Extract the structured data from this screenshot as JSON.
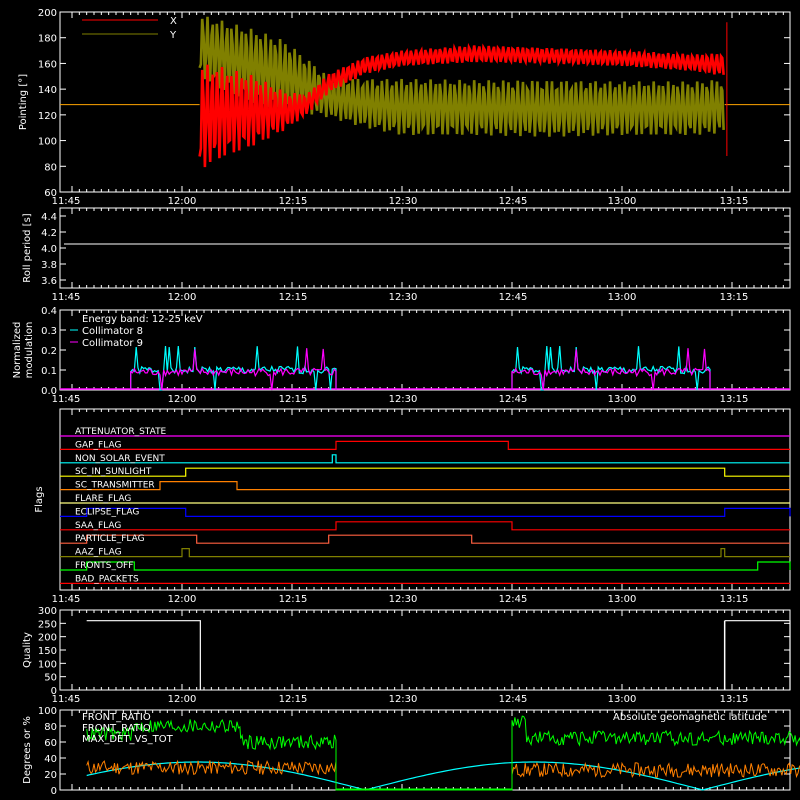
{
  "chart_data": [
    {
      "type": "line",
      "ylabel": "Pointing [°]",
      "ylim": [
        60,
        200
      ],
      "yticks": [
        "60",
        "80",
        "100",
        "120",
        "140",
        "160",
        "180",
        "200"
      ],
      "xticks": [
        "11:45",
        "12:00",
        "12:15",
        "12:30",
        "12:45",
        "13:00",
        "13:15"
      ],
      "xrange_minutes": [
        -1,
        59
      ],
      "series": [
        {
          "name": "X",
          "color": "#ff0000",
          "envelope": [
            [
              2.2,
              null,
              null
            ],
            [
              2.4,
              76,
              160
            ],
            [
              5,
              85,
              158
            ],
            [
              10,
              96,
              150
            ],
            [
              14,
              108,
              138
            ],
            [
              17,
              120,
              136
            ],
            [
              20,
              137,
              152
            ],
            [
              25,
              152,
              165
            ],
            [
              30,
              158,
              170
            ],
            [
              40,
              161,
              174
            ],
            [
              50,
              160,
              172
            ],
            [
              60,
              158,
              170
            ],
            [
              70,
              154,
              167
            ],
            [
              74,
              150,
              168
            ]
          ]
        },
        {
          "name": "Y",
          "color": "#808000",
          "envelope": [
            [
              2.4,
              150,
              198
            ],
            [
              5,
              140,
              194
            ],
            [
              10,
              128,
              186
            ],
            [
              14,
              122,
              178
            ],
            [
              17,
              121,
              164
            ],
            [
              20,
              118,
              150
            ],
            [
              25,
              110,
              148
            ],
            [
              30,
              104,
              148
            ],
            [
              40,
              104,
              147
            ],
            [
              50,
              103,
              147
            ],
            [
              60,
              104,
              146
            ],
            [
              70,
              104,
              146
            ],
            [
              74,
              106,
              148
            ]
          ]
        }
      ],
      "baseline": 128
    },
    {
      "type": "line",
      "ylabel": "Roll period [s]",
      "ylim": [
        3.5,
        4.5
      ],
      "yticks": [
        "3.6",
        "3.8",
        "4.0",
        "4.2",
        "4.4"
      ],
      "xticks": [
        "11:45",
        "12:00",
        "12:15",
        "12:30",
        "12:45",
        "13:00",
        "13:15"
      ],
      "value": 4.05
    },
    {
      "type": "line",
      "ylabel": "Normalized modulation",
      "ylim": [
        0,
        0.4
      ],
      "yticks": [
        "0.0",
        "0.1",
        "0.2",
        "0.3",
        "0.4"
      ],
      "xticks": [
        "11:45",
        "12:00",
        "12:15",
        "12:30",
        "12:45",
        "13:00",
        "13:15"
      ],
      "annotation": "Energy band: 12-25 keV",
      "series": [
        {
          "name": "Collimator 8",
          "color": "#00ffff",
          "segments": [
            [
              -7,
              21
            ],
            [
              45,
              72
            ]
          ],
          "level": 0.1
        },
        {
          "name": "Collimator 9",
          "color": "#ff00ff",
          "segments": [
            [
              -7,
              21
            ],
            [
              45,
              72
            ]
          ],
          "level": 0.09
        }
      ]
    },
    {
      "type": "line",
      "ylabel": "Flags",
      "xticks": [
        "11:45",
        "12:00",
        "12:15",
        "12:30",
        "12:45",
        "13:00",
        "13:15"
      ],
      "flags": [
        {
          "name": "ATTENUATOR_STATE",
          "color": "#ff00ff",
          "highs": []
        },
        {
          "name": "GAP_FLAG",
          "color": "#ff0000",
          "highs": [
            [
              21,
              44.5
            ]
          ]
        },
        {
          "name": "NON_SOLAR_EVENT",
          "color": "#00ffff",
          "highs": [
            [
              20.5,
              21
            ]
          ]
        },
        {
          "name": "SC_IN_SUNLIGHT",
          "color": "#ffff00",
          "highs": [
            [
              0.5,
              74
            ]
          ]
        },
        {
          "name": "SC_TRANSMITTER",
          "color": "#ff8000",
          "highs": [
            [
              -3,
              7.5
            ]
          ]
        },
        {
          "name": "FLARE_FLAG",
          "color": "#ffff80",
          "highs": []
        },
        {
          "name": "ECLIPSE_FLAG",
          "color": "#0000ff",
          "highs": [
            [
              -13,
              0.5
            ],
            [
              74,
              90
            ]
          ]
        },
        {
          "name": "SAA_FLAG",
          "color": "#ff0000",
          "highs": [
            [
              21,
              45
            ]
          ]
        },
        {
          "name": "PARTICLE_FLAG",
          "color": "#ff6040",
          "highs": [
            [
              -13,
              2
            ],
            [
              20,
              39.5
            ]
          ]
        },
        {
          "name": "AAZ_FLAG",
          "color": "#808000",
          "highs": [
            [
              0,
              1
            ],
            [
              73.5,
              74
            ]
          ]
        },
        {
          "name": "FRONTS_OFF",
          "color": "#00ff00",
          "highs": [
            [
              -13,
              -6.5
            ],
            [
              78.5,
              90
            ]
          ]
        },
        {
          "name": "BAD_PACKETS",
          "color": "#ff0000",
          "highs": []
        }
      ]
    },
    {
      "type": "line",
      "ylabel": "Quality",
      "ylim": [
        0,
        300
      ],
      "yticks": [
        "0",
        "50",
        "100",
        "150",
        "200",
        "250",
        "300"
      ],
      "xticks": [
        "11:45",
        "12:00",
        "12:15",
        "12:30",
        "12:45",
        "13:00",
        "13:15"
      ],
      "segments": [
        [
          -13,
          2.5,
          260
        ],
        [
          74,
          90,
          260
        ]
      ]
    },
    {
      "type": "line",
      "ylabel": "Degrees or %",
      "ylim": [
        0,
        100
      ],
      "yticks": [
        "0",
        "20",
        "40",
        "60",
        "80",
        "100"
      ],
      "annotation": "Absolute geomagnetic latitude",
      "series": [
        {
          "name": "FRONT_RATIO",
          "color": "#ffff00"
        },
        {
          "name": "FRONT_RATIO",
          "color": "#00ff00",
          "levels": [
            [
              -13,
              -6.5,
              70
            ],
            [
              -6.5,
              8,
              80
            ],
            [
              8,
              21,
              60
            ],
            [
              45,
              47,
              85
            ],
            [
              47,
              90,
              65
            ]
          ]
        },
        {
          "name": "MAX_DET_VS_TOT",
          "color": "#ff8000",
          "levels": [
            [
              -13,
              21,
              28
            ],
            [
              45,
              90,
              25
            ]
          ]
        },
        {
          "name": "Absolute geomagnetic latitude",
          "color": "#00ffff"
        }
      ]
    }
  ]
}
